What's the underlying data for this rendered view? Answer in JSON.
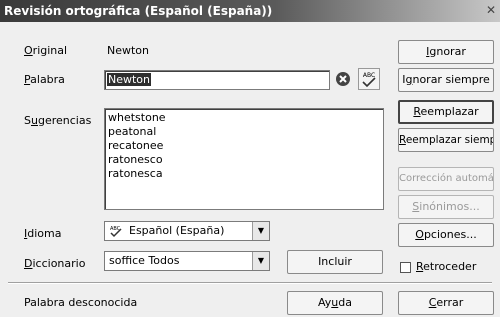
{
  "window": {
    "title": "Revisión ortográfica (Español (España))"
  },
  "original": {
    "label_first": "O",
    "label_rest": "riginal",
    "value": "Newton"
  },
  "palabra": {
    "label_first": "P",
    "label_rest": "alabra",
    "value": "Newton"
  },
  "sugerencias": {
    "label_pre": "S",
    "label_u": "u",
    "label_rest": "gerencias",
    "items": [
      "whetstone",
      "peatonal",
      "recatonee",
      "ratonesco",
      "ratonesca"
    ]
  },
  "idioma": {
    "label_first": "I",
    "label_rest": "dioma",
    "value": "Español (España)"
  },
  "diccionario": {
    "label_first": "D",
    "label_rest": "iccionario",
    "value": "soffice Todos"
  },
  "buttons": {
    "ignorar": {
      "first": "I",
      "rest": "gnorar"
    },
    "ignorar_siempre": {
      "pre": "I",
      "u": "g",
      "rest": "norar siempre"
    },
    "reemplazar": {
      "first": "R",
      "rest": "eemplazar"
    },
    "reemplazar_siempre": {
      "first": "R",
      "rest": "eemplazar siempre"
    },
    "correccion": "Corrección automática",
    "sinonimos": {
      "first": "S",
      "rest": "inónimos..."
    },
    "opciones": {
      "first": "O",
      "rest": "pciones..."
    },
    "incluir": "Incluir",
    "ayuda": {
      "pre": "Ay",
      "u": "u",
      "rest": "da"
    },
    "cerrar": {
      "first": "C",
      "rest": "errar"
    }
  },
  "retroceder": {
    "first": "R",
    "rest": "etroceder",
    "checked": false
  },
  "status": "Palabra desconocida",
  "icons": {
    "clear": "clear-circle-x-icon",
    "abc": "spellcheck-abc-icon",
    "lang": "language-abc-icon"
  }
}
